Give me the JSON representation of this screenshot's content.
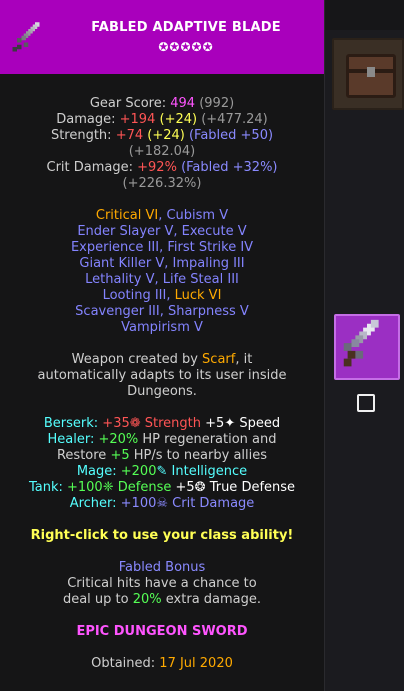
{
  "item": {
    "title": "FABLED ADAPTIVE BLADE",
    "stars": "✪✪✪✪✪",
    "header_color": "#a900bc"
  },
  "stats": {
    "gear_score_label": "Gear Score: ",
    "gear_score_value": "494",
    "gear_score_extra": " (992)",
    "damage_label": "Damage: ",
    "damage_value": "+194",
    "damage_bonus": " (+24)",
    "damage_extra": " (+477.24)",
    "strength_label": "Strength: ",
    "strength_value": "+74",
    "strength_bonus": " (+24)",
    "strength_reforge": " (Fabled +50)",
    "strength_extra": "(+182.04)",
    "crit_label": "Crit Damage: ",
    "crit_value": "+92%",
    "crit_reforge": " (Fabled +32%)",
    "crit_extra": "(+226.32%)"
  },
  "enchants": {
    "line1_a": "Critical VI",
    "line1_b": ", Cubism V",
    "line2": "Ender Slayer V, Execute V",
    "line3": "Experience III, First Strike IV",
    "line4": "Giant Killer V, Impaling III",
    "line5": "Lethality V, Life Steal III",
    "line6_a": "Looting III, ",
    "line6_b": "Luck VI",
    "line7": "Scavenger III, Sharpness V",
    "line8": "Vampirism V"
  },
  "description": {
    "line1_a": "Weapon created by ",
    "line1_name": "Scarf",
    "line1_b": ", it",
    "line2": "automatically adapts to its user inside",
    "line3": "Dungeons."
  },
  "classes": {
    "berserk_label": "Berserk: ",
    "berserk_a": "+35",
    "berserk_str_icon": "❁",
    "berserk_str": " Strength",
    "berserk_b": " +5",
    "berserk_spd_icon": "✦",
    "berserk_spd": " Speed",
    "healer_label": "Healer: ",
    "healer_a": "+20%",
    "healer_b": " HP regeneration and",
    "healer_line2_a": "Restore ",
    "healer_line2_b": "+5",
    "healer_line2_c": " HP/s to nearby allies",
    "mage_label": "Mage: ",
    "mage_a": "+200",
    "mage_icon": "✎",
    "mage_b": " Intelligence",
    "tank_label": "Tank: ",
    "tank_a": "+100",
    "tank_def_icon": "❈",
    "tank_b": " Defense",
    "tank_c": " +5",
    "tank_true_icon": "❂",
    "tank_d": " True Defense",
    "archer_label": "Archer: ",
    "archer_a": "+100",
    "archer_icon": "☠",
    "archer_b": " Crit Damage"
  },
  "ability": "Right-click to use your class ability!",
  "bonus": {
    "title": "Fabled Bonus",
    "line1": "Critical hits have a chance to",
    "line2_a": "deal up to ",
    "line2_b": "20%",
    "line2_c": " extra damage."
  },
  "rarity": "EPIC DUNGEON SWORD",
  "obtained": {
    "label": "Obtained: ",
    "date": "17 Jul 2020"
  }
}
